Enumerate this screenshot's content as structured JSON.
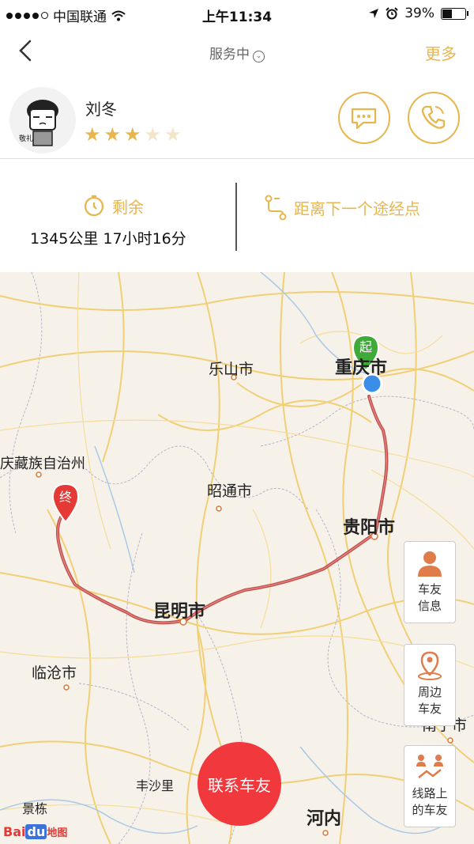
{
  "status_bar": {
    "carrier": "中国联通",
    "time": "上午11:34",
    "battery": "39%"
  },
  "nav": {
    "title": "服务中",
    "more": "更多"
  },
  "driver": {
    "name": "刘冬",
    "rating": 3,
    "max_rating": 5,
    "avatar_caption": "敬礼"
  },
  "stats": {
    "remaining_label": "剩余",
    "remaining_value": "1345公里  17小时16分",
    "next_label": "距离下一个途经点"
  },
  "map": {
    "cities": {
      "leshan": "乐山市",
      "chongqing": "重庆市",
      "zhaotong": "昭通市",
      "guiyang": "贵阳市",
      "kunming": "昆明市",
      "lincang": "临沧市",
      "diqing": "庆藏族自治州",
      "nanning": "南宁市",
      "hanoi": "河内",
      "jinghong": "景栋",
      "fengshali": "丰沙里"
    },
    "start_marker": "起",
    "end_marker": "终",
    "buttons": {
      "driver_info": [
        "车友",
        "信息"
      ],
      "nearby": [
        "周边",
        "车友"
      ],
      "route_friends": [
        "线路上",
        "的车友"
      ]
    },
    "contact_button": "联系车友",
    "logo_bai": "Bai",
    "logo_du": "du",
    "logo_map": "地图"
  },
  "colors": {
    "accent": "#e7b64e",
    "route": "#c0504d",
    "contact": "#f0383d"
  }
}
